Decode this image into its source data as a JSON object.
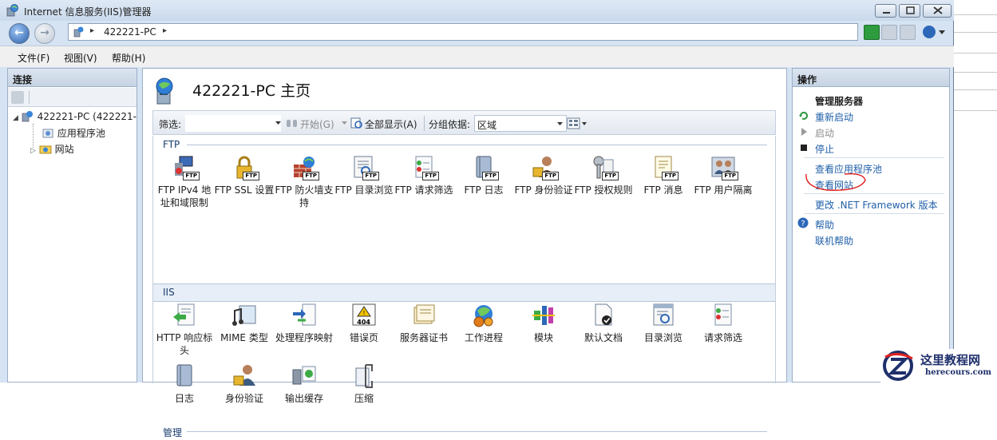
{
  "window": {
    "title": "Internet 信息服务(IIS)管理器",
    "controls": [
      "minimize",
      "maximize",
      "close"
    ]
  },
  "address_bar": {
    "crumb": "422221-PC",
    "separator": "▸"
  },
  "menu": {
    "items": [
      "文件(F)",
      "视图(V)",
      "帮助(H)"
    ]
  },
  "connections": {
    "title": "连接",
    "tree": [
      {
        "label": "422221-PC (422221-",
        "icon": "server-icon"
      },
      {
        "label": "应用程序池",
        "icon": "app-pool-icon"
      },
      {
        "label": "网站",
        "icon": "sites-folder-icon"
      }
    ]
  },
  "main": {
    "title": "422221-PC 主页",
    "filter": {
      "label": "筛选:",
      "start": "开始(G)",
      "show_all": "全部显示(A)",
      "group_by_label": "分组依据:",
      "group_by_value": "区域"
    },
    "groups": {
      "ftp": {
        "label": "FTP",
        "items": [
          {
            "label": "FTP IPv4 地址和域限制",
            "badge": "FTP"
          },
          {
            "label": "FTP SSL 设置",
            "badge": "FTP"
          },
          {
            "label": "FTP 防火墙支持",
            "badge": "FTP"
          },
          {
            "label": "FTP 目录浏览",
            "badge": "FTP"
          },
          {
            "label": "FTP 请求筛选",
            "badge": "FTP"
          },
          {
            "label": "FTP 日志",
            "badge": "FTP"
          },
          {
            "label": "FTP 身份验证",
            "badge": "FTP"
          },
          {
            "label": "FTP 授权规则",
            "badge": "FTP"
          },
          {
            "label": "FTP 消息",
            "badge": "FTP"
          },
          {
            "label": "FTP 用户隔离",
            "badge": "FTP"
          }
        ]
      },
      "iis": {
        "label": "IIS",
        "items": [
          {
            "label": "HTTP 响应标头"
          },
          {
            "label": "MIME 类型"
          },
          {
            "label": "处理程序映射"
          },
          {
            "label": "错误页",
            "badge": "404"
          },
          {
            "label": "服务器证书"
          },
          {
            "label": "工作进程"
          },
          {
            "label": "模块"
          },
          {
            "label": "默认文档"
          },
          {
            "label": "目录浏览"
          },
          {
            "label": "请求筛选"
          },
          {
            "label": "日志"
          },
          {
            "label": "身份验证"
          },
          {
            "label": "输出缓存"
          },
          {
            "label": "压缩"
          }
        ]
      },
      "manage": {
        "label": "管理"
      }
    }
  },
  "actions": {
    "title": "操作",
    "manage_server": "管理服务器",
    "restart": "重新启动",
    "start": "启动",
    "stop": "停止",
    "view_app_pools": "查看应用程序池",
    "view_sites": "查看网站",
    "change_net": "更改 .NET Framework 版本",
    "help": "帮助",
    "online_help": "联机帮助"
  },
  "watermark": {
    "title": "这里教程网",
    "url": "herecours.com"
  },
  "colors": {
    "link": "#1f5fa8",
    "annotation": "#e02020",
    "window_frame": "#d5e3f2"
  }
}
